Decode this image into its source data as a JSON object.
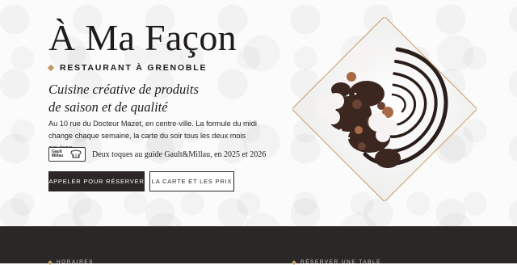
{
  "hero": {
    "title": "À Ma Façon",
    "subtitle": "RESTAURANT À GRENOBLE",
    "tagline": [
      "Cuisine créative de produits",
      "de saison et de qualité"
    ],
    "description": [
      "Au 10 rue du Docteur Mazet, en centre-ville. La formule du midi",
      "change chaque semaine, la carte du soir tous les deux mois environ."
    ],
    "award": {
      "logo_text_line1": "Gault",
      "logo_text_line2": "Millau",
      "logo_icon": "toque-icon",
      "text": "Deux toques au guide Gault&Millau, en 2025 et 2026"
    },
    "buttons": {
      "call": "APPELER POUR RÉSERVER",
      "menu": "LA CARTE ET LES PRIX"
    },
    "photo_alt": "plated-dessert-image"
  },
  "footer": {
    "hours_label": "HORAIRES",
    "reserve_label": "RÉSERVER UNE TABLE"
  },
  "colors": {
    "accent": "#c59a62",
    "dark": "#2b2726",
    "footer_bg": "#2a2726"
  }
}
